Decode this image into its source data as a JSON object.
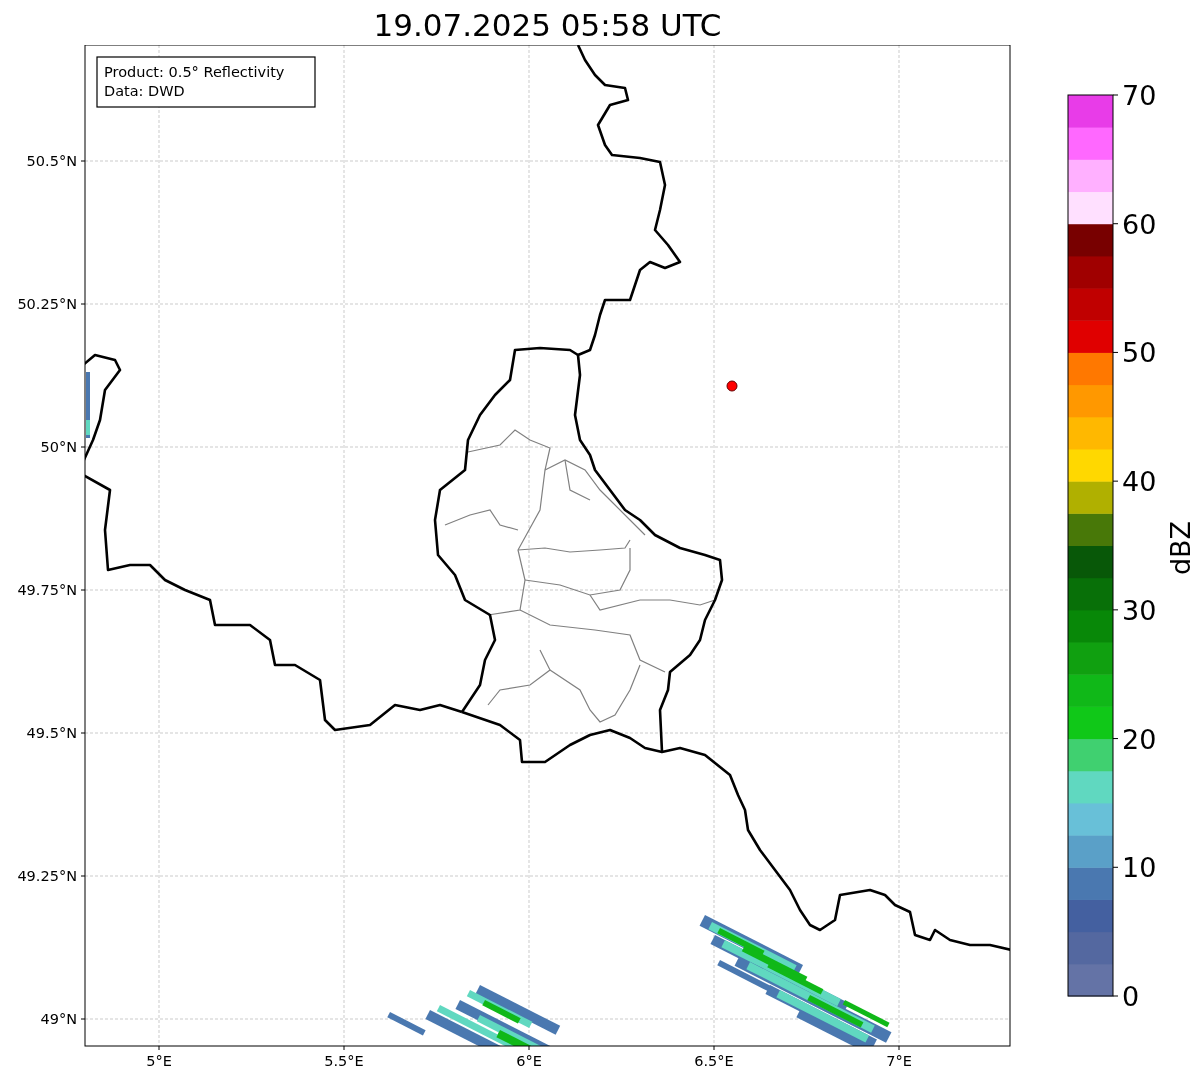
{
  "title": "19.07.2025 05:58 UTC",
  "map": {
    "info_box": [
      "Product: 0.5° Reflectivity",
      "Data: DWD"
    ],
    "xticks": [
      "5°E",
      "5.5°E",
      "6°E",
      "6.5°E",
      "7°E"
    ],
    "yticks": [
      "50.5°N",
      "50.25°N",
      "50°N",
      "49.75°N",
      "49.5°N",
      "49.25°N",
      "49°N"
    ]
  },
  "colorbar": {
    "label": "dBZ",
    "ticks": [
      "70",
      "60",
      "50",
      "40",
      "30",
      "20",
      "10",
      "0"
    ],
    "segments": [
      {
        "color": "#6473a6"
      },
      {
        "color": "#5468a0"
      },
      {
        "color": "#4460a0"
      },
      {
        "color": "#4a78b0"
      },
      {
        "color": "#5aa0c8"
      },
      {
        "color": "#68c0d8"
      },
      {
        "color": "#60d8c0"
      },
      {
        "color": "#40d070"
      },
      {
        "color": "#10c818"
      },
      {
        "color": "#10b818"
      },
      {
        "color": "#10a010"
      },
      {
        "color": "#088808"
      },
      {
        "color": "#087008"
      },
      {
        "color": "#085808"
      },
      {
        "color": "#487808"
      },
      {
        "color": "#b0b000"
      },
      {
        "color": "#ffd800"
      },
      {
        "color": "#ffb800"
      },
      {
        "color": "#ff9800"
      },
      {
        "color": "#ff7800"
      },
      {
        "color": "#e00000"
      },
      {
        "color": "#c00000"
      },
      {
        "color": "#a00000"
      },
      {
        "color": "#780000"
      },
      {
        "color": "#ffe0ff"
      },
      {
        "color": "#ffb0ff"
      },
      {
        "color": "#ff68ff"
      },
      {
        "color": "#e83ce8"
      }
    ]
  }
}
